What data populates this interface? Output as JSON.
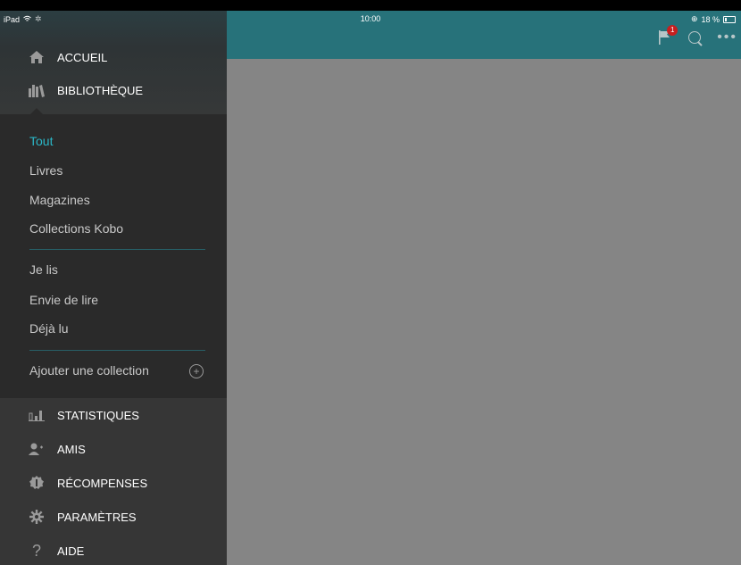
{
  "statusbar": {
    "device": "iPad",
    "time": "10:00",
    "battery": "18 %"
  },
  "sidebar": {
    "main_items": [
      {
        "label": "ACCUEIL",
        "icon": "home-icon"
      },
      {
        "label": "BIBLIOTHÈQUE",
        "icon": "library-icon"
      }
    ],
    "library_items": [
      {
        "label": "Tout",
        "active": true
      },
      {
        "label": "Livres",
        "active": false
      },
      {
        "label": "Magazines",
        "active": false
      },
      {
        "label": "Collections Kobo",
        "active": false
      }
    ],
    "reading_items": [
      {
        "label": "Je lis"
      },
      {
        "label": "Envie de lire"
      },
      {
        "label": "Déjà lu"
      }
    ],
    "add_collection": "Ajouter une collection",
    "bottom_items": [
      {
        "label": "STATISTIQUES",
        "icon": "stats-icon"
      },
      {
        "label": "AMIS",
        "icon": "friends-icon"
      },
      {
        "label": "RÉCOMPENSES",
        "icon": "rewards-icon"
      },
      {
        "label": "PARAMÈTRES",
        "icon": "settings-icon"
      },
      {
        "label": "AIDE",
        "icon": "help-icon"
      }
    ]
  },
  "topbar": {
    "notification_count": "1",
    "accent_color": "#27727a",
    "badge_color": "#c81f1f"
  }
}
